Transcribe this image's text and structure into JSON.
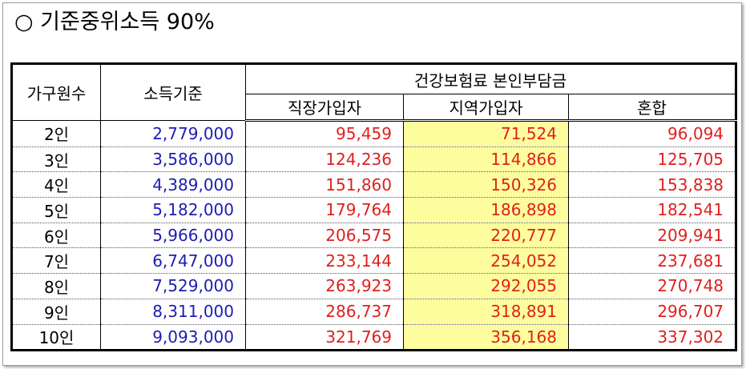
{
  "title": "○ 기준중위소득 90%",
  "colors": {
    "income_text": "#1c1cb4",
    "premium_text": "#e0201e",
    "highlight_bg": "#fdfd9d"
  },
  "table": {
    "headers": {
      "household": "가구원수",
      "income": "소득기준",
      "group": "건강보험료 본인부담금",
      "workplace": "직장가입자",
      "regional": "지역가입자",
      "mixed": "혼합"
    },
    "rows": [
      {
        "size": "2인",
        "income": "2,779,000",
        "workplace": "95,459",
        "regional": "71,524",
        "mixed": "96,094"
      },
      {
        "size": "3인",
        "income": "3,586,000",
        "workplace": "124,236",
        "regional": "114,866",
        "mixed": "125,705"
      },
      {
        "size": "4인",
        "income": "4,389,000",
        "workplace": "151,860",
        "regional": "150,326",
        "mixed": "153,838"
      },
      {
        "size": "5인",
        "income": "5,182,000",
        "workplace": "179,764",
        "regional": "186,898",
        "mixed": "182,541"
      },
      {
        "size": "6인",
        "income": "5,966,000",
        "workplace": "206,575",
        "regional": "220,777",
        "mixed": "209,941"
      },
      {
        "size": "7인",
        "income": "6,747,000",
        "workplace": "233,144",
        "regional": "254,052",
        "mixed": "237,681"
      },
      {
        "size": "8인",
        "income": "7,529,000",
        "workplace": "263,923",
        "regional": "292,055",
        "mixed": "270,748"
      },
      {
        "size": "9인",
        "income": "8,311,000",
        "workplace": "286,737",
        "regional": "318,891",
        "mixed": "296,707"
      },
      {
        "size": "10인",
        "income": "9,093,000",
        "workplace": "321,769",
        "regional": "356,168",
        "mixed": "337,302"
      }
    ]
  }
}
